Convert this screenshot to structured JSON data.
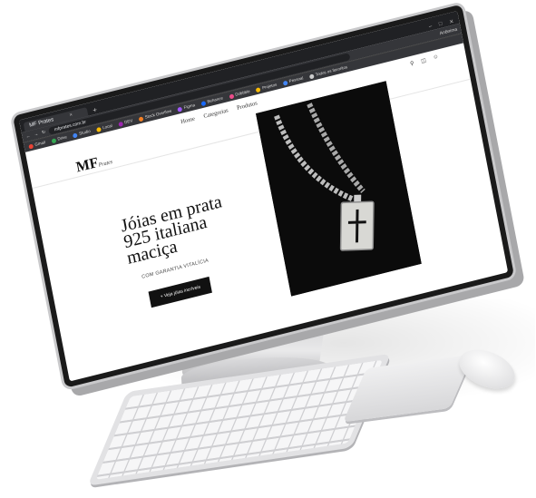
{
  "browser": {
    "tab_title": "MF Prates",
    "tab_close": "×",
    "new_tab": "+",
    "window_controls": [
      "–",
      "□",
      "✕"
    ],
    "url": "mfprates.com.br",
    "profile_label": "Anônima",
    "bookmarks": [
      {
        "label": "Gmail",
        "color": "#ea4335"
      },
      {
        "label": "Drive",
        "color": "#34a853"
      },
      {
        "label": "Studio",
        "color": "#4285f4"
      },
      {
        "label": "Local",
        "color": "#fbbc05"
      },
      {
        "label": "DEV",
        "color": "#9c27b0"
      },
      {
        "label": "Stock Overflow",
        "color": "#f48024"
      },
      {
        "label": "Figma",
        "color": "#a259ff"
      },
      {
        "label": "Behance",
        "color": "#1769ff"
      },
      {
        "label": "Dribbble",
        "color": "#ea4c89"
      },
      {
        "label": "Projetos",
        "color": "#fbbc05"
      },
      {
        "label": "Pessoal",
        "color": "#4285f4"
      },
      {
        "label": "Todos os favoritos",
        "color": "#cccccc"
      }
    ]
  },
  "site": {
    "logo_mark": "MF",
    "logo_script": "Prates",
    "nav": [
      "Home",
      "Categorias",
      "Produtos"
    ],
    "icons": [
      "search-icon",
      "cart-icon",
      "user-icon"
    ],
    "hero_title": "Jóias em prata 925 italiana maciça",
    "hero_subtitle": "COM GARANTIA VITALÍCIA",
    "cta_label": "+ Veja jóias incríveis"
  }
}
